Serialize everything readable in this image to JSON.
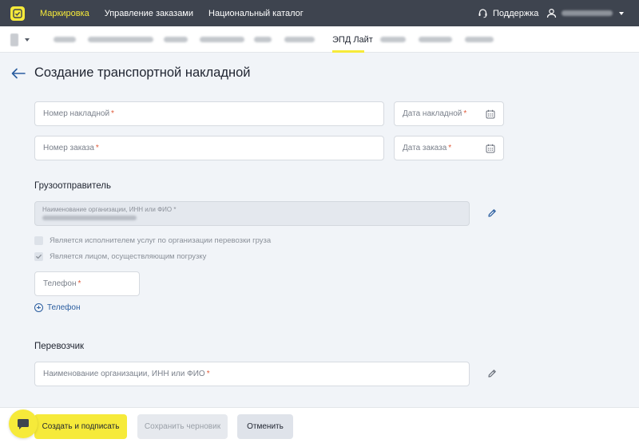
{
  "topbar": {
    "nav": [
      {
        "label": "Маркировка",
        "active": true
      },
      {
        "label": "Управление заказами",
        "active": false
      },
      {
        "label": "Национальный каталог",
        "active": false
      }
    ],
    "support_label": "Поддержка",
    "icons": {
      "logo": "chestny-znak-logo",
      "support": "headset-icon",
      "user": "user-icon"
    }
  },
  "subnav": {
    "active_tab": "ЭПД Лайт"
  },
  "page": {
    "title": "Создание транспортной накладной"
  },
  "form": {
    "invoice_number_placeholder": "Номер накладной",
    "invoice_date_placeholder": "Дата накладной",
    "order_number_placeholder": "Номер заказа",
    "order_date_placeholder": "Дата заказа",
    "shipper": {
      "section_title": "Грузоотправитель",
      "org_label": "Наименование организации, ИНН или ФИО",
      "checkbox_carrier_services": {
        "label": "Является исполнителем услуг по организации перевозки груза",
        "checked": false
      },
      "checkbox_loading": {
        "label": "Является лицом, осуществляющим погрузку",
        "checked": true
      },
      "phone_placeholder": "Телефон",
      "add_phone_label": "Телефон"
    },
    "carrier": {
      "section_title": "Перевозчик",
      "org_placeholder": "Наименование организации, ИНН или ФИО"
    },
    "required_mark": "*"
  },
  "footer": {
    "create_sign_label": "Создать и подписать",
    "save_draft_label": "Сохранить черновик",
    "cancel_label": "Отменить"
  },
  "colors": {
    "accent": "#f6ea3a",
    "topbar": "#3e444f",
    "link": "#2a5d9f",
    "required": "#e05a39",
    "background": "#f1f4f8"
  }
}
